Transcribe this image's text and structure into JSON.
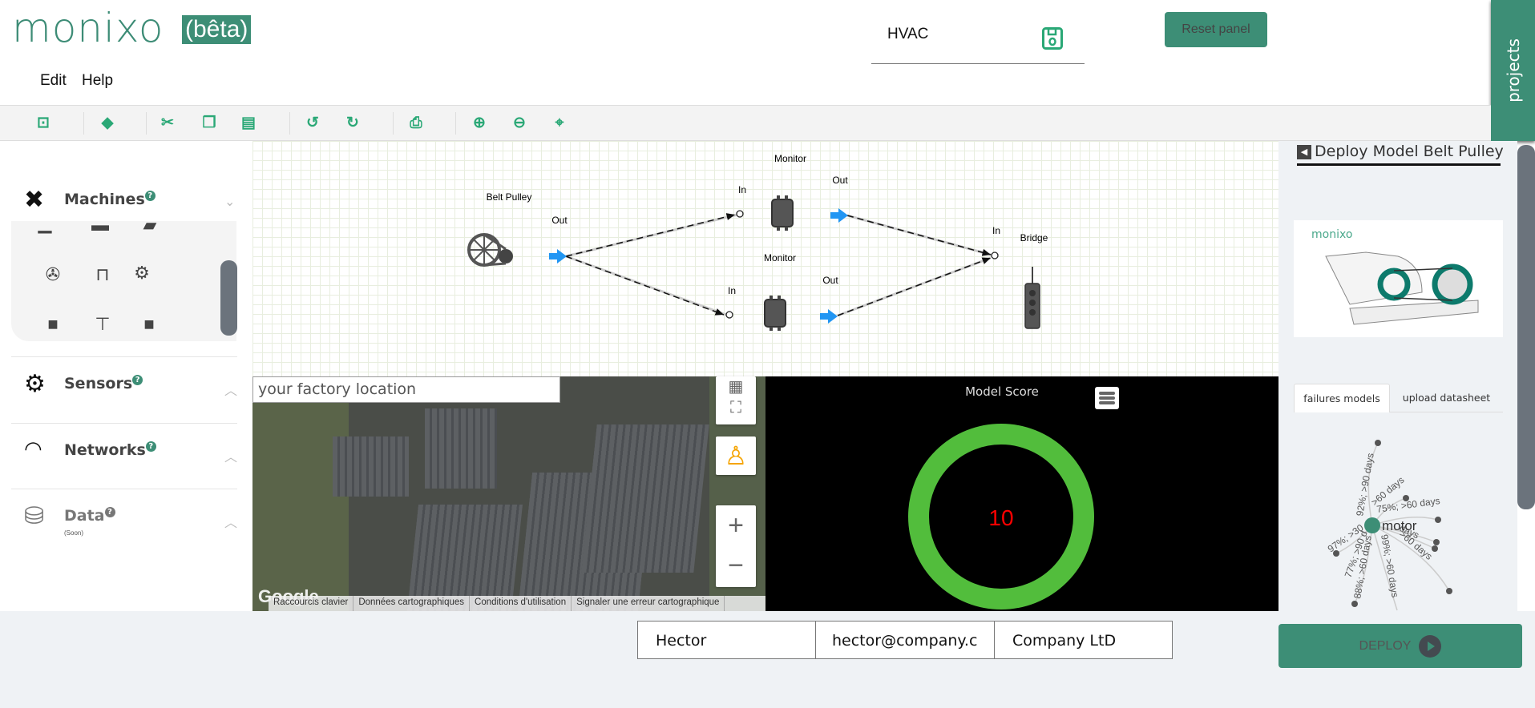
{
  "header": {
    "logo": "monixo",
    "beta": "(bêta)",
    "menu": [
      "Edit",
      "Help"
    ],
    "project_name": "HVAC",
    "reset_label": "Reset panel",
    "projects_tab": "projects"
  },
  "toolbar": {
    "icons": [
      "fit-page-icon",
      "eraser-icon",
      "cut-icon",
      "copy-icon",
      "paste-icon",
      "undo-icon",
      "redo-icon",
      "print-icon",
      "zoom-in-icon",
      "zoom-out-icon",
      "center-icon"
    ]
  },
  "sidebar": {
    "sections": [
      {
        "label": "Machines",
        "help": "?",
        "expanded": true
      },
      {
        "label": "Sensors",
        "help": "?",
        "expanded": false
      },
      {
        "label": "Networks",
        "help": "?",
        "expanded": false
      },
      {
        "label": "Data",
        "help": "?",
        "note": "(Soon)",
        "expanded": false
      }
    ]
  },
  "diagram": {
    "nodes": {
      "belt_pulley": {
        "label": "Belt Pulley",
        "out": "Out"
      },
      "monitor1": {
        "label": "Monitor",
        "in": "In",
        "out": "Out"
      },
      "monitor2": {
        "label": "Monitor",
        "in": "In",
        "out": "Out"
      },
      "bridge": {
        "label": "Bridge",
        "in": "In"
      }
    }
  },
  "map": {
    "search_placeholder": "your factory location",
    "google": "Google",
    "footer": [
      "Raccourcis clavier",
      "Données cartographiques",
      "Conditions d'utilisation",
      "Signaler une erreur cartographique"
    ]
  },
  "score": {
    "title": "Model Score",
    "value": "10",
    "ring_color": "#52bd3c",
    "value_color": "#ff0000"
  },
  "right_panel": {
    "title": "Deploy Model Belt Pulley",
    "image_logo": "monixo",
    "tabs": [
      "failures models",
      "upload datasheet"
    ],
    "active_tab": 0,
    "tree": {
      "root": "motor",
      "labels": [
        "92%; >90 days",
        "75%; >60 days",
        ">60 days",
        "97%; >30",
        "99%; >60 days",
        "88%; >60 days",
        "77%; >90 d",
        "days",
        ">60 days"
      ]
    }
  },
  "form": {
    "name": "Hector",
    "email": "hector@company.c",
    "company": "Company LtD",
    "deploy_label": "DEPLOY"
  },
  "colors": {
    "brand": "#3d8e76",
    "toolbar_icon": "#2aa876",
    "port_arrow": "#2196f3"
  }
}
